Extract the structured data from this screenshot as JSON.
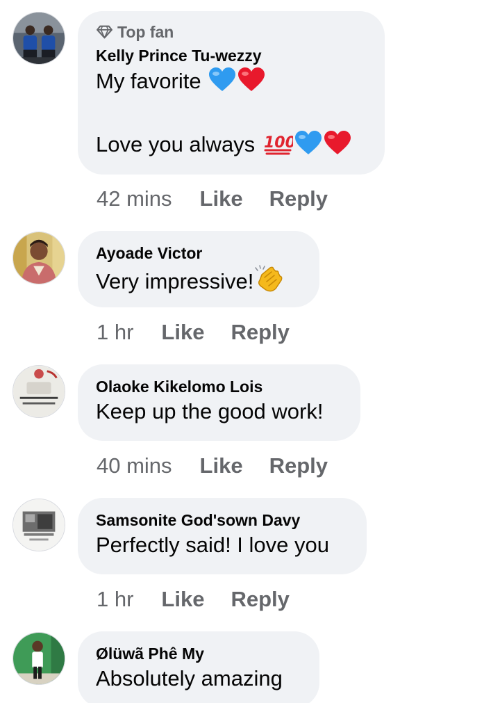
{
  "comments": [
    {
      "badge": "Top fan",
      "badge_icon": "diamond-icon",
      "author": "Kelly Prince Tu-wezzy",
      "lines": [
        "My favorite",
        "Love you always"
      ],
      "emojis_line1": [
        "blue-heart-emoji",
        "red-heart-emoji"
      ],
      "emojis_line2": [
        "hundred-points-emoji",
        "blue-heart-emoji",
        "red-heart-emoji"
      ],
      "time": "42 mins",
      "like": "Like",
      "reply": "Reply"
    },
    {
      "author": "Ayoade Victor",
      "text": "Very impressive!",
      "emojis": [
        "clapping-hands-emoji"
      ],
      "time": "1 hr",
      "like": "Like",
      "reply": "Reply"
    },
    {
      "author": "Olaoke Kikelomo Lois",
      "text": "Keep up the good work!",
      "time": "40 mins",
      "like": "Like",
      "reply": "Reply"
    },
    {
      "author": "Samsonite God'sown Davy",
      "text": "Perfectly said! I love you",
      "time": "1 hr",
      "like": "Like",
      "reply": "Reply"
    },
    {
      "author": "Ølüwã Phê My",
      "text": "Absolutely amazing"
    }
  ],
  "colors": {
    "bubble": "#f0f2f5",
    "secondary_text": "#65676b",
    "primary_text": "#050505",
    "blue_heart": "#2f9bf0",
    "red_heart": "#e8192c",
    "hundred": "#e0242f",
    "clap": "#f5b91c"
  }
}
